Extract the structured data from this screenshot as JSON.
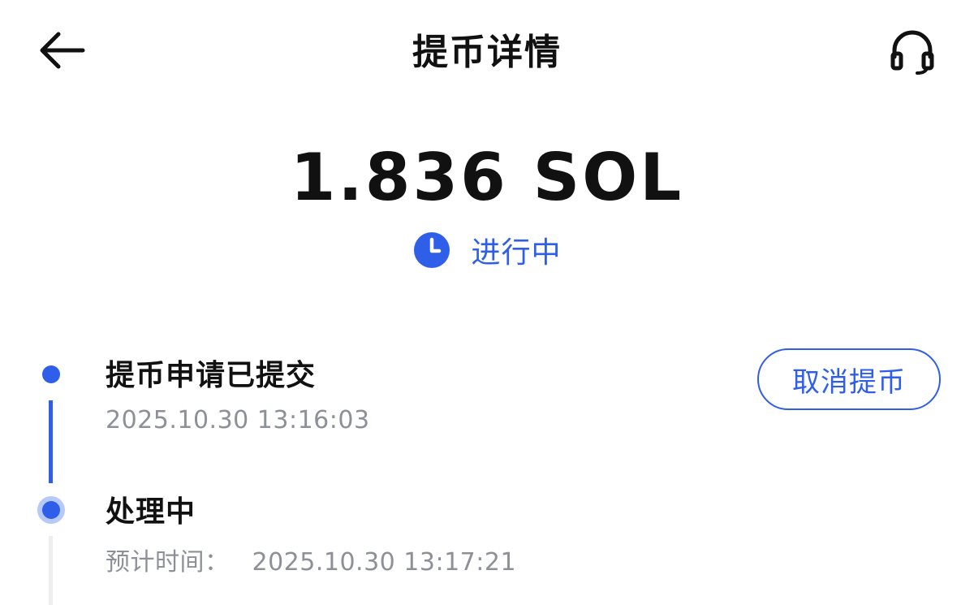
{
  "header": {
    "title": "提币详情",
    "back_icon": "arrow-left-icon",
    "support_icon": "headphones-icon"
  },
  "withdrawal": {
    "amount": "1.836 SOL",
    "status": "进行中",
    "status_icon": "clock-icon",
    "status_color": "#2f5ee8"
  },
  "timeline": {
    "steps": [
      {
        "title": "提币申请已提交",
        "time": "2025.10.30 13:16:03",
        "state": "done"
      },
      {
        "title": "处理中",
        "time_label": "预计时间：",
        "time": "2025.10.30 13:17:21",
        "state": "active"
      }
    ],
    "cancel_label": "取消提币"
  },
  "colors": {
    "accent": "#2f5ee8",
    "muted_text": "#8e9097",
    "pending_line": "#eeeeee"
  }
}
